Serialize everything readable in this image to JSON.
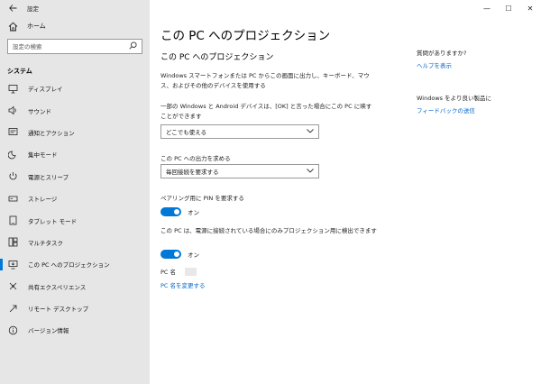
{
  "window": {
    "title": "設定",
    "minimize": "—",
    "maximize": "☐",
    "close": "✕"
  },
  "sidebar": {
    "home": "ホーム",
    "search_placeholder": "設定の検索",
    "section": "システム",
    "items": [
      {
        "label": "ディスプレイ",
        "icon": "display-icon"
      },
      {
        "label": "サウンド",
        "icon": "sound-icon"
      },
      {
        "label": "通知とアクション",
        "icon": "notifications-icon"
      },
      {
        "label": "集中モード",
        "icon": "focus-assist-icon"
      },
      {
        "label": "電源とスリープ",
        "icon": "power-icon"
      },
      {
        "label": "ストレージ",
        "icon": "storage-icon"
      },
      {
        "label": "タブレット モード",
        "icon": "tablet-icon"
      },
      {
        "label": "マルチタスク",
        "icon": "multitasking-icon"
      },
      {
        "label": "この PC へのプロジェクション",
        "icon": "projection-icon"
      },
      {
        "label": "共有エクスペリエンス",
        "icon": "shared-experiences-icon"
      },
      {
        "label": "リモート デスクトップ",
        "icon": "remote-desktop-icon"
      },
      {
        "label": "バージョン情報",
        "icon": "about-icon"
      }
    ],
    "active_index": 8
  },
  "main": {
    "title": "この PC へのプロジェクション",
    "subtitle": "この PC へのプロジェクション",
    "description": "Windows スマートフォンまたは PC からこの画面に出力し、キーボード、マウス、およびその他のデバイスを使用する",
    "setting1_label": "一部の Windows と Android デバイスは、[OK] と言った場合にこの PC に映すことができます",
    "setting1_value": "どこでも使える",
    "setting2_label": "この PC への出力を求める",
    "setting2_value": "毎回接続を要求する",
    "setting3_label": "ペアリング用に PIN を要求する",
    "setting3_state": "オン",
    "setting4_label": "この PC は、電源に接続されている場合にのみプロジェクション用に検出できます",
    "setting4_state": "オン",
    "pcname_label": "PC 名",
    "rename_link": "PC 名を変更する"
  },
  "right": {
    "help_heading": "質問がありますか?",
    "help_link": "ヘルプを表示",
    "feedback_heading": "Windows をより良い製品に",
    "feedback_link": "フィードバックの送信"
  },
  "colors": {
    "accent": "#0078d7",
    "link": "#0066cc",
    "sidebar_bg": "#e6e6e6"
  }
}
